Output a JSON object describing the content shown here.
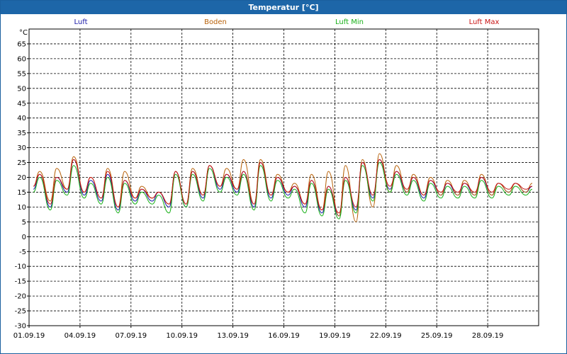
{
  "window": {
    "title": "Temperatur [°C]"
  },
  "chart_data": {
    "type": "line",
    "title": "Temperatur [°C]",
    "ylabel": "°C",
    "xlabel": "",
    "ylim": [
      -30,
      70
    ],
    "yticks": [
      65,
      60,
      55,
      50,
      45,
      40,
      35,
      30,
      25,
      20,
      15,
      10,
      5,
      0,
      -5,
      -10,
      -15,
      -20,
      -25,
      -30
    ],
    "x_start": "2019-09-01",
    "x_end": "2019-10-01",
    "x_ticks": [
      "01.09.19",
      "04.09.19",
      "07.09.19",
      "10.09.19",
      "13.09.19",
      "16.09.19",
      "19.09.19",
      "22.09.19",
      "25.09.19",
      "28.09.19"
    ],
    "grid": true,
    "legend": "top",
    "x": [
      "2019-09-01",
      "2019-09-02",
      "2019-09-03",
      "2019-09-04",
      "2019-09-05",
      "2019-09-06",
      "2019-09-07",
      "2019-09-08",
      "2019-09-09",
      "2019-09-10",
      "2019-09-11",
      "2019-09-12",
      "2019-09-13",
      "2019-09-14",
      "2019-09-15",
      "2019-09-16",
      "2019-09-17",
      "2019-09-18",
      "2019-09-19",
      "2019-09-20",
      "2019-09-21",
      "2019-09-22",
      "2019-09-23",
      "2019-09-24",
      "2019-09-25",
      "2019-09-26",
      "2019-09-27",
      "2019-09-28",
      "2019-09-29",
      "2019-09-30"
    ],
    "series": [
      {
        "name": "Luft",
        "color": "#1a1aa8",
        "tmin": [
          16,
          10,
          15,
          14,
          12,
          9,
          12,
          12,
          10,
          10,
          13,
          16,
          15,
          10,
          13,
          14,
          10,
          8,
          7,
          9,
          13,
          16,
          15,
          13,
          14,
          14,
          14,
          14,
          15,
          15
        ],
        "tmax": [
          21,
          20,
          26,
          19,
          21,
          19,
          16,
          15,
          22,
          22,
          24,
          21,
          22,
          25,
          20,
          17,
          19,
          17,
          20,
          25,
          26,
          22,
          20,
          19,
          18,
          18,
          20,
          18,
          18,
          17
        ]
      },
      {
        "name": "Boden",
        "color": "#b8620a",
        "tmin": [
          17,
          12,
          16,
          15,
          13,
          10,
          13,
          13,
          11,
          11,
          14,
          17,
          16,
          11,
          14,
          15,
          11,
          9,
          7,
          5,
          10,
          15,
          15,
          14,
          14,
          14,
          14,
          14,
          15,
          15
        ],
        "tmax": [
          22,
          23,
          27,
          20,
          23,
          22,
          17,
          15,
          22,
          23,
          24,
          23,
          26,
          26,
          21,
          18,
          21,
          22,
          24,
          26,
          28,
          24,
          21,
          20,
          19,
          19,
          21,
          18,
          18,
          18
        ]
      },
      {
        "name": "Luft Min",
        "color": "#18b018",
        "tmin": [
          15,
          9,
          14,
          13,
          11,
          8,
          11,
          11,
          8,
          10,
          12,
          15,
          14,
          9,
          12,
          13,
          8,
          7,
          6,
          8,
          12,
          15,
          14,
          12,
          13,
          13,
          13,
          13,
          14,
          14
        ],
        "tmax": [
          20,
          19,
          24,
          18,
          20,
          18,
          15,
          14,
          21,
          21,
          23,
          20,
          21,
          24,
          19,
          16,
          18,
          16,
          19,
          24,
          25,
          21,
          19,
          18,
          17,
          17,
          19,
          17,
          17,
          16
        ]
      },
      {
        "name": "Luft Max",
        "color": "#c81414",
        "tmin": [
          17,
          11,
          16,
          15,
          13,
          10,
          13,
          13,
          11,
          11,
          14,
          17,
          16,
          11,
          14,
          15,
          11,
          9,
          8,
          10,
          14,
          17,
          16,
          14,
          15,
          15,
          15,
          15,
          16,
          16
        ],
        "tmax": [
          21,
          20,
          26,
          20,
          22,
          19,
          16,
          15,
          22,
          22,
          24,
          21,
          22,
          25,
          20,
          17,
          19,
          17,
          20,
          25,
          26,
          22,
          20,
          19,
          18,
          18,
          20,
          18,
          18,
          17
        ]
      }
    ]
  }
}
